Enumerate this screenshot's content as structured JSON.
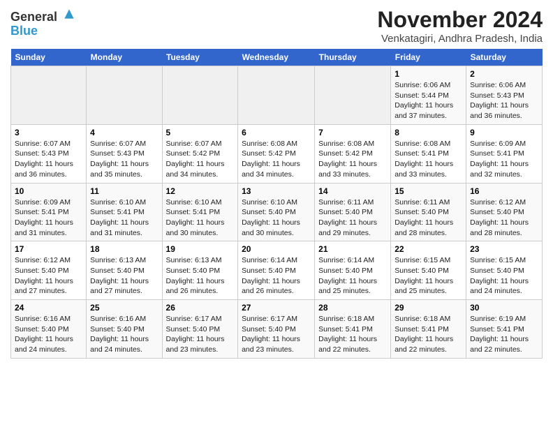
{
  "logo": {
    "general": "General",
    "blue": "Blue"
  },
  "title": "November 2024",
  "subtitle": "Venkatagiri, Andhra Pradesh, India",
  "weekdays": [
    "Sunday",
    "Monday",
    "Tuesday",
    "Wednesday",
    "Thursday",
    "Friday",
    "Saturday"
  ],
  "weeks": [
    [
      {
        "day": "",
        "info": ""
      },
      {
        "day": "",
        "info": ""
      },
      {
        "day": "",
        "info": ""
      },
      {
        "day": "",
        "info": ""
      },
      {
        "day": "",
        "info": ""
      },
      {
        "day": "1",
        "info": "Sunrise: 6:06 AM\nSunset: 5:44 PM\nDaylight: 11 hours and 37 minutes."
      },
      {
        "day": "2",
        "info": "Sunrise: 6:06 AM\nSunset: 5:43 PM\nDaylight: 11 hours and 36 minutes."
      }
    ],
    [
      {
        "day": "3",
        "info": "Sunrise: 6:07 AM\nSunset: 5:43 PM\nDaylight: 11 hours and 36 minutes."
      },
      {
        "day": "4",
        "info": "Sunrise: 6:07 AM\nSunset: 5:43 PM\nDaylight: 11 hours and 35 minutes."
      },
      {
        "day": "5",
        "info": "Sunrise: 6:07 AM\nSunset: 5:42 PM\nDaylight: 11 hours and 34 minutes."
      },
      {
        "day": "6",
        "info": "Sunrise: 6:08 AM\nSunset: 5:42 PM\nDaylight: 11 hours and 34 minutes."
      },
      {
        "day": "7",
        "info": "Sunrise: 6:08 AM\nSunset: 5:42 PM\nDaylight: 11 hours and 33 minutes."
      },
      {
        "day": "8",
        "info": "Sunrise: 6:08 AM\nSunset: 5:41 PM\nDaylight: 11 hours and 33 minutes."
      },
      {
        "day": "9",
        "info": "Sunrise: 6:09 AM\nSunset: 5:41 PM\nDaylight: 11 hours and 32 minutes."
      }
    ],
    [
      {
        "day": "10",
        "info": "Sunrise: 6:09 AM\nSunset: 5:41 PM\nDaylight: 11 hours and 31 minutes."
      },
      {
        "day": "11",
        "info": "Sunrise: 6:10 AM\nSunset: 5:41 PM\nDaylight: 11 hours and 31 minutes."
      },
      {
        "day": "12",
        "info": "Sunrise: 6:10 AM\nSunset: 5:41 PM\nDaylight: 11 hours and 30 minutes."
      },
      {
        "day": "13",
        "info": "Sunrise: 6:10 AM\nSunset: 5:40 PM\nDaylight: 11 hours and 30 minutes."
      },
      {
        "day": "14",
        "info": "Sunrise: 6:11 AM\nSunset: 5:40 PM\nDaylight: 11 hours and 29 minutes."
      },
      {
        "day": "15",
        "info": "Sunrise: 6:11 AM\nSunset: 5:40 PM\nDaylight: 11 hours and 28 minutes."
      },
      {
        "day": "16",
        "info": "Sunrise: 6:12 AM\nSunset: 5:40 PM\nDaylight: 11 hours and 28 minutes."
      }
    ],
    [
      {
        "day": "17",
        "info": "Sunrise: 6:12 AM\nSunset: 5:40 PM\nDaylight: 11 hours and 27 minutes."
      },
      {
        "day": "18",
        "info": "Sunrise: 6:13 AM\nSunset: 5:40 PM\nDaylight: 11 hours and 27 minutes."
      },
      {
        "day": "19",
        "info": "Sunrise: 6:13 AM\nSunset: 5:40 PM\nDaylight: 11 hours and 26 minutes."
      },
      {
        "day": "20",
        "info": "Sunrise: 6:14 AM\nSunset: 5:40 PM\nDaylight: 11 hours and 26 minutes."
      },
      {
        "day": "21",
        "info": "Sunrise: 6:14 AM\nSunset: 5:40 PM\nDaylight: 11 hours and 25 minutes."
      },
      {
        "day": "22",
        "info": "Sunrise: 6:15 AM\nSunset: 5:40 PM\nDaylight: 11 hours and 25 minutes."
      },
      {
        "day": "23",
        "info": "Sunrise: 6:15 AM\nSunset: 5:40 PM\nDaylight: 11 hours and 24 minutes."
      }
    ],
    [
      {
        "day": "24",
        "info": "Sunrise: 6:16 AM\nSunset: 5:40 PM\nDaylight: 11 hours and 24 minutes."
      },
      {
        "day": "25",
        "info": "Sunrise: 6:16 AM\nSunset: 5:40 PM\nDaylight: 11 hours and 24 minutes."
      },
      {
        "day": "26",
        "info": "Sunrise: 6:17 AM\nSunset: 5:40 PM\nDaylight: 11 hours and 23 minutes."
      },
      {
        "day": "27",
        "info": "Sunrise: 6:17 AM\nSunset: 5:40 PM\nDaylight: 11 hours and 23 minutes."
      },
      {
        "day": "28",
        "info": "Sunrise: 6:18 AM\nSunset: 5:41 PM\nDaylight: 11 hours and 22 minutes."
      },
      {
        "day": "29",
        "info": "Sunrise: 6:18 AM\nSunset: 5:41 PM\nDaylight: 11 hours and 22 minutes."
      },
      {
        "day": "30",
        "info": "Sunrise: 6:19 AM\nSunset: 5:41 PM\nDaylight: 11 hours and 22 minutes."
      }
    ]
  ]
}
